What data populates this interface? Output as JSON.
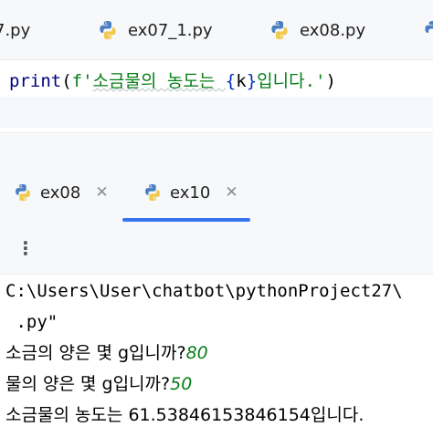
{
  "editor_tabs": [
    {
      "label": "7.py"
    },
    {
      "label": "ex07_1.py"
    },
    {
      "label": "ex08.py"
    },
    {
      "label": ""
    }
  ],
  "code": {
    "fn": "print",
    "open": "(",
    "prefix": "f'",
    "str1": "소금물의 농도는 ",
    "brace_open": "{",
    "var": "k",
    "brace_close": "}",
    "str2": "입니다.'",
    "close": ")"
  },
  "run_tabs": [
    {
      "label": "ex08",
      "close": "✕"
    },
    {
      "label": "ex10",
      "close": "✕"
    }
  ],
  "toolbar": {
    "more": "⋮"
  },
  "console": {
    "path_line": "C:\\Users\\User\\chatbot\\pythonProject27\\",
    "path_cont": " .py\"",
    "q1": "소금의 양은 몇 g입니까?",
    "a1": "80",
    "q2": "물의 양은 몇 g입니까?",
    "a2": "50",
    "result": "소금물의 농도는 61.53846153846154입니다."
  },
  "colors": {
    "accent": "#3574f0",
    "string": "#067d17",
    "keyword": "#000080"
  }
}
